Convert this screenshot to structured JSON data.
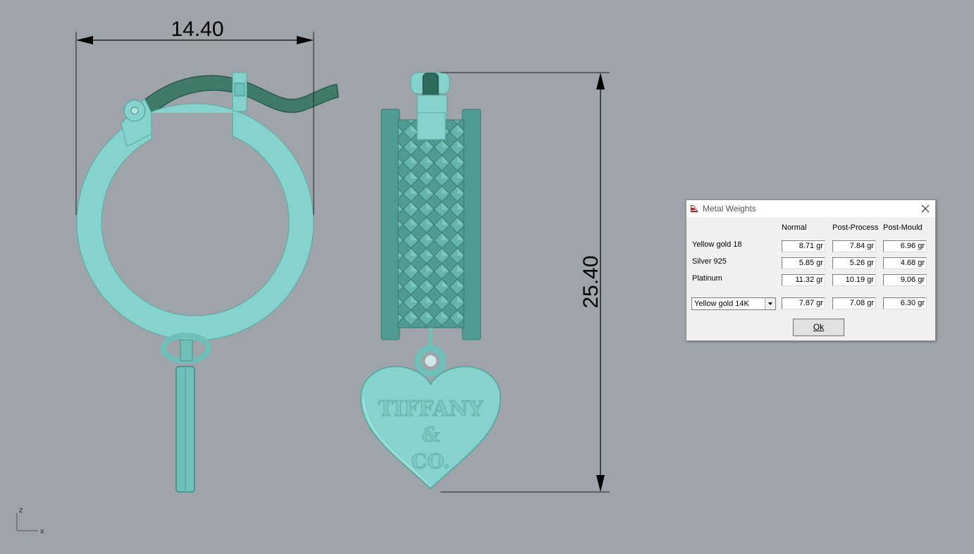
{
  "viewport": {
    "dimension_width": "14.40",
    "dimension_height": "25.40",
    "axis_z": "z",
    "axis_x": "x",
    "tag_text": [
      "TIFFANY",
      "&",
      "CO."
    ],
    "colors": {
      "background": "#9ea4aa",
      "body": "#86d2cc",
      "dark": "#4a8f86",
      "hook": "#3f7b68"
    }
  },
  "dialog": {
    "title": "Metal Weights",
    "columns": [
      "Normal",
      "Post-Process",
      "Post-Mould"
    ],
    "rows": [
      {
        "label": "Yellow gold 18",
        "values": [
          "8.71 gr",
          "7.84 gr",
          "6.96 gr"
        ]
      },
      {
        "label": "Silver 925",
        "values": [
          "5.85 gr",
          "5.26 gr",
          "4.68 gr"
        ]
      },
      {
        "label": "Platinum",
        "values": [
          "11.32 gr",
          "10.19 gr",
          "9.06 gr"
        ]
      }
    ],
    "custom": {
      "selected": "Yellow gold 14K",
      "values": [
        "7.87 gr",
        "7.08 gr",
        "6.30 gr"
      ]
    },
    "ok_label": "Ok"
  }
}
